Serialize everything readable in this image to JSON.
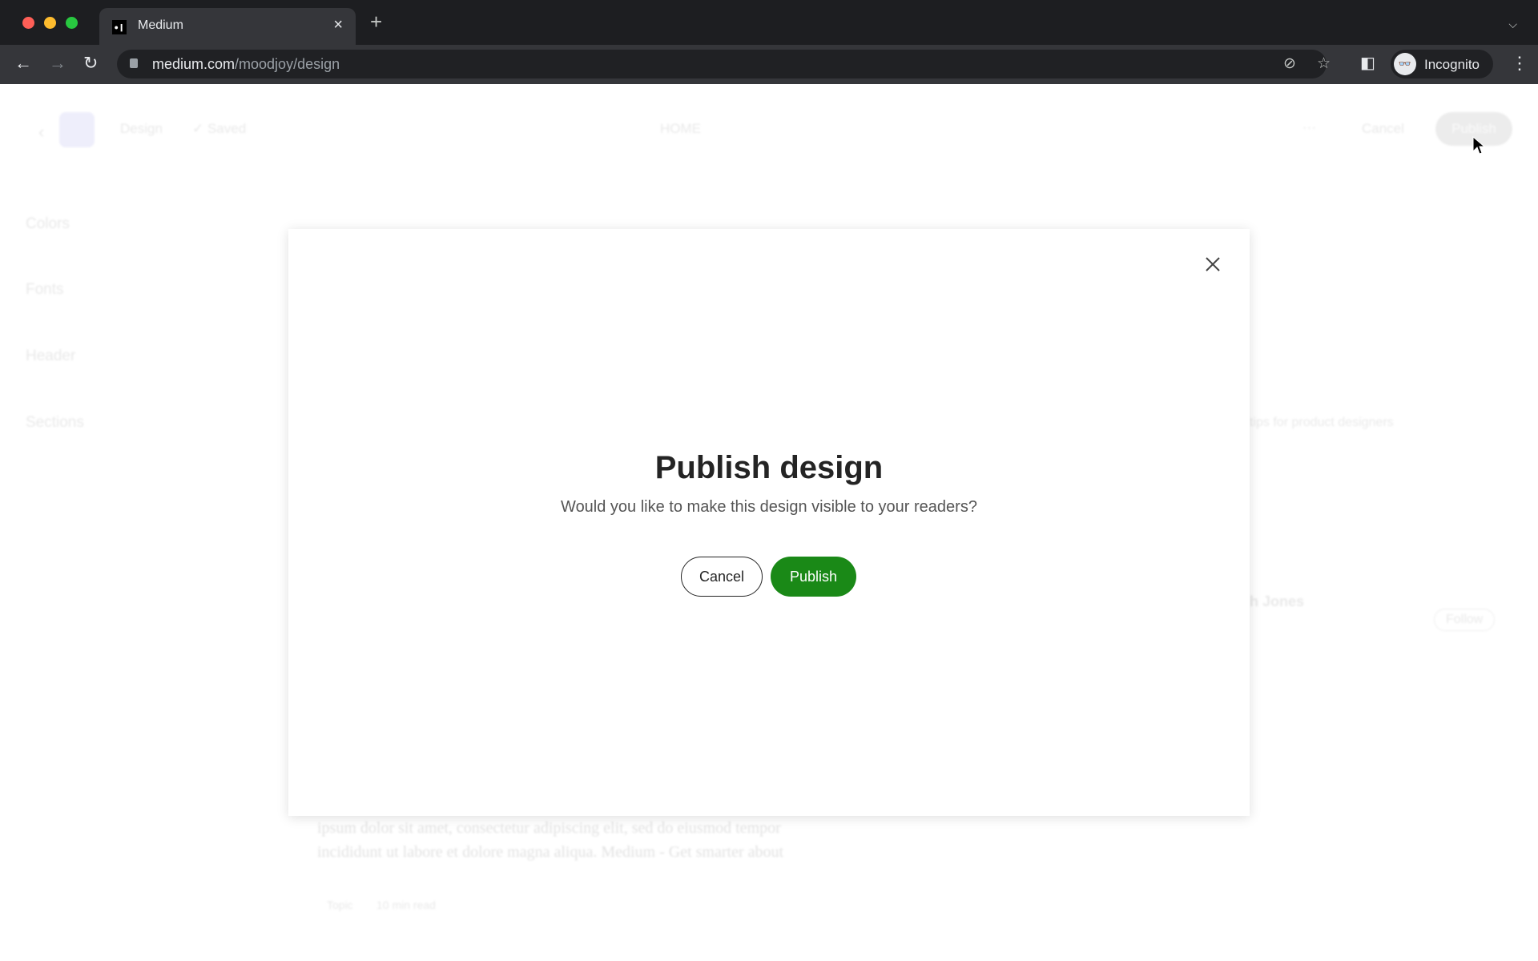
{
  "browser": {
    "tab_title": "Medium",
    "favicon": "medium-logo",
    "url_host": "medium.com",
    "url_path": "/moodjoy/design",
    "profile_label": "Incognito",
    "traffic_lights": [
      "#ff5f57",
      "#febc2e",
      "#28c840"
    ]
  },
  "background": {
    "header": {
      "title": "Design",
      "status": "Saved",
      "page_select": "HOME",
      "cancel_label": "Cancel",
      "publish_label": "Publish"
    },
    "sidebar": {
      "items": [
        {
          "label": "Colors"
        },
        {
          "label": "Fonts"
        },
        {
          "label": "Header"
        },
        {
          "label": "Sections"
        }
      ]
    },
    "preview": {
      "tagline": "tips for product designers",
      "author": "h Jones",
      "follow_label": "Follow",
      "excerpt_lines": [
        "ipsum dolor sit amet, consectetur adipiscing elit, sed do eiusmod tempor",
        "incididunt ut labore et dolore magna aliqua. Medium - Get smarter about"
      ],
      "topic": "Topic",
      "read_time": "10 min read"
    }
  },
  "dialog": {
    "title": "Publish design",
    "message": "Would you like to make this design visible to your readers?",
    "cancel_label": "Cancel",
    "publish_label": "Publish",
    "accent_color": "#1a8917"
  }
}
